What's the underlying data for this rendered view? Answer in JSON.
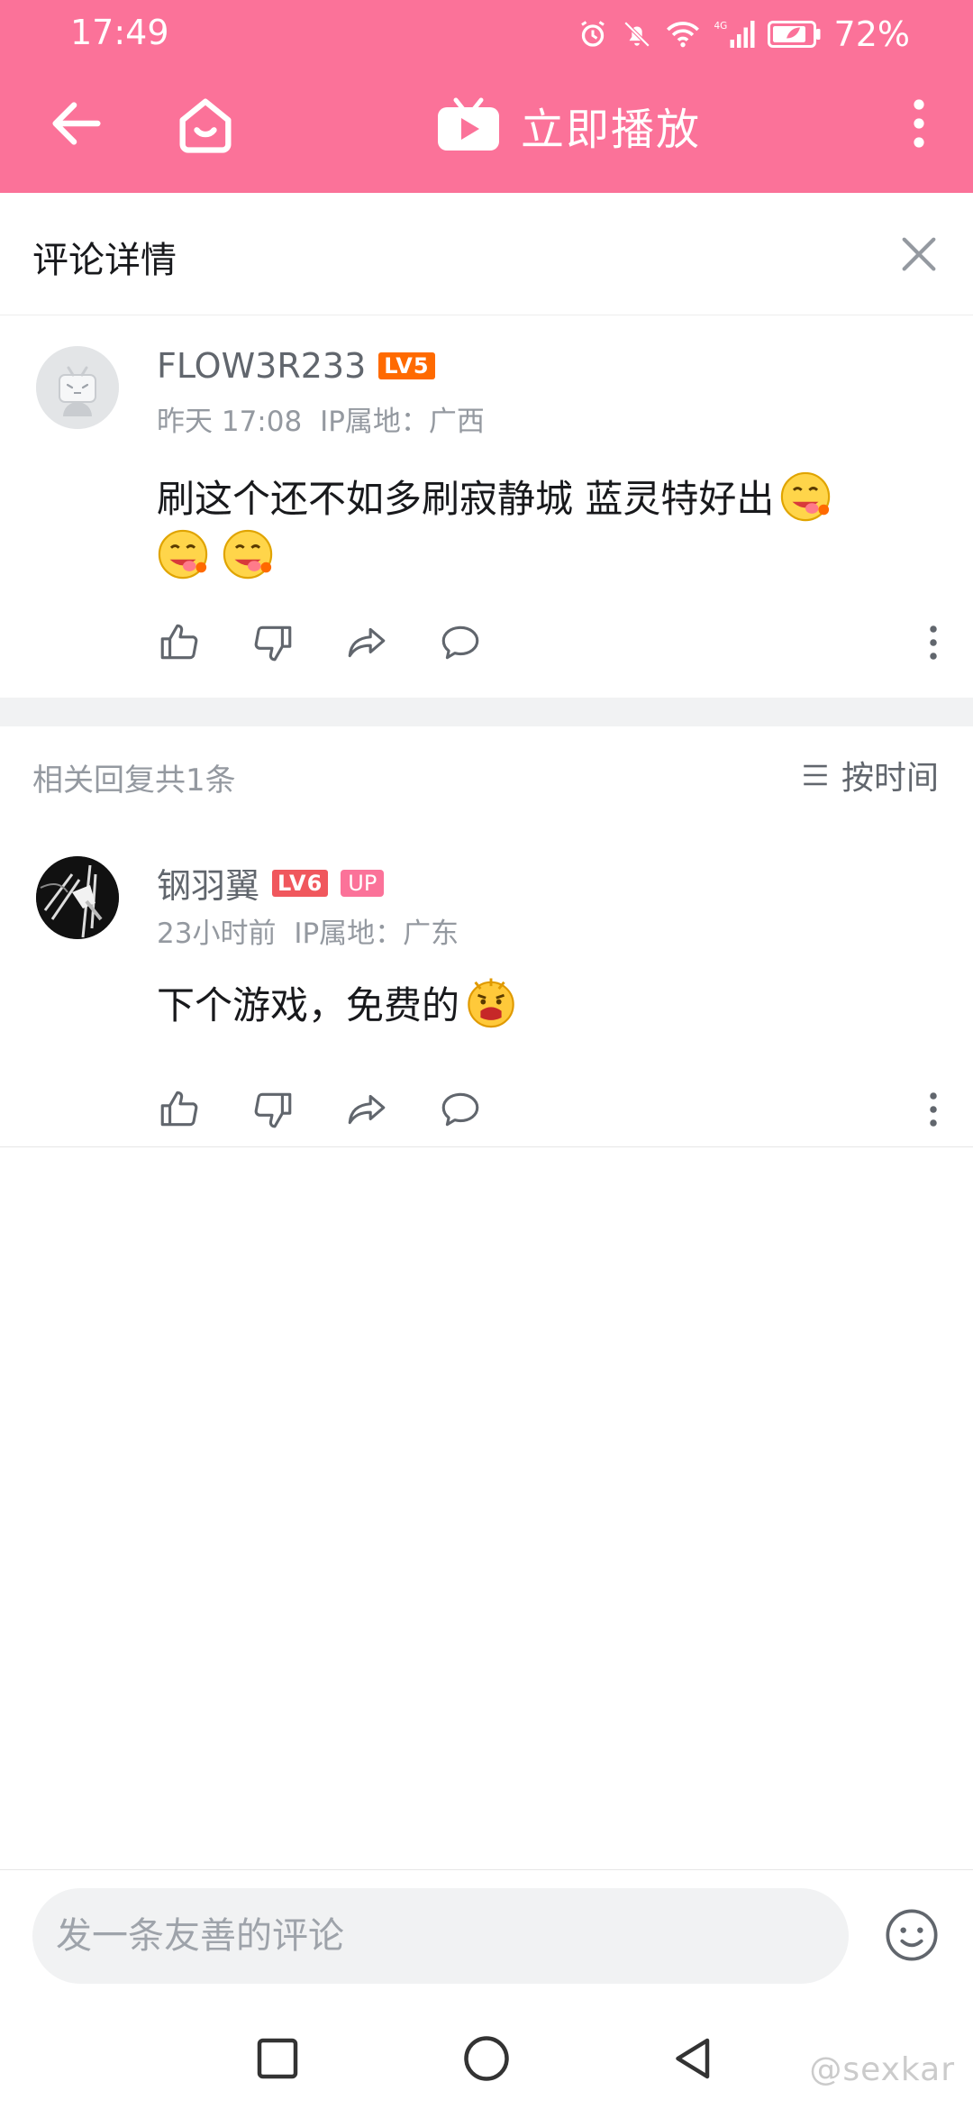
{
  "status_bar": {
    "time": "17:49",
    "battery": "72%",
    "network": "4G"
  },
  "app_bar": {
    "title": "立即播放",
    "back_icon": "back-arrow-icon",
    "home_icon": "home-icon",
    "play_icon": "tv-play-icon",
    "more_icon": "more-vertical-icon"
  },
  "detail_header": {
    "title": "评论详情",
    "close_icon": "close-icon"
  },
  "main_comment": {
    "username": "FLOW3R233",
    "level": "LV5",
    "date": "昨天 17:08",
    "ip": "IP属地：广西",
    "text": "刷这个还不如多刷寂静城 蓝灵特好出",
    "emoji_count": 3
  },
  "replies_header": {
    "count_label": "相关回复共1条",
    "sort_label": "按时间"
  },
  "reply": {
    "username": "钢羽翼",
    "level": "LV6",
    "badge": "UP",
    "date": "23小时前",
    "ip": "IP属地：广东",
    "text": "下个游戏，免费的"
  },
  "comment_input": {
    "placeholder": "发一条友善的评论"
  },
  "watermark": "@sexkar",
  "colors": {
    "brand_pink": "#fb7299",
    "lv5": "#ff6a00",
    "lv6": "#f0575d",
    "text_primary": "#18191c",
    "text_secondary": "#9499a0"
  }
}
